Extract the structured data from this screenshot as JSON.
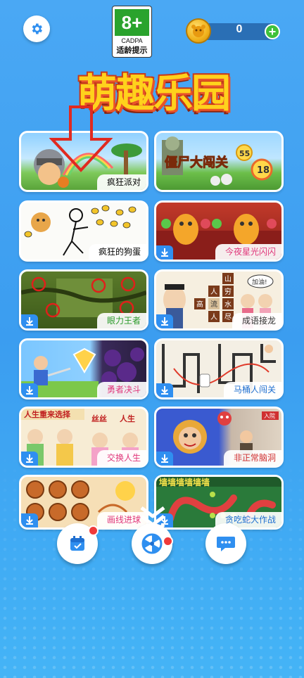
{
  "header": {
    "age_rating": "8+",
    "age_org": "CADPA",
    "age_tip": "适龄提示",
    "coins": "0",
    "plus_label": "+"
  },
  "logo_text": "萌趣乐园",
  "games": [
    {
      "label": "疯狂派对",
      "label_color": "#333333",
      "download": false
    },
    {
      "label": "",
      "label_color": "#333333",
      "download": false
    },
    {
      "label": "疯狂的狗蛋",
      "label_color": "#333333",
      "download": false
    },
    {
      "label": "今夜星光闪闪",
      "label_color": "#e0367a",
      "download": true
    },
    {
      "label": "眼力王者",
      "label_color": "#2a9a2a",
      "download": true
    },
    {
      "label": "成语接龙",
      "label_color": "#333333",
      "download": true
    },
    {
      "label": "勇者决斗",
      "label_color": "#e0367a",
      "download": true
    },
    {
      "label": "马桶人闯关",
      "label_color": "#1f6fd0",
      "download": true
    },
    {
      "label": "交换人生",
      "label_color": "#e0367a",
      "download": true
    },
    {
      "label": "非正常脑洞",
      "label_color": "#d03030",
      "download": true
    },
    {
      "label": "画线进球",
      "label_color": "#e0367a",
      "download": true
    },
    {
      "label": "贪吃蛇大作战",
      "label_color": "#1f6fd0",
      "download": true
    }
  ],
  "thumb_texts": {
    "pvz_title": "僵尸大闯关",
    "sun_55": "55",
    "sun_18": "18",
    "idiom_chars": [
      "山",
      "穷",
      "人",
      "水",
      "高",
      "流",
      "尽",
      "人"
    ],
    "idiom_bubble": "加油!",
    "swap_title": "人生重来选择",
    "swap_tag1": "丝丝",
    "swap_tag2": "人生",
    "snake_wall": "墙墙墙墙墙墙",
    "brain_tag": "入院"
  },
  "colors": {
    "accent": "#2f8ff0",
    "badge_red": "#f03a3a",
    "age_green": "#2aa32d"
  },
  "icons": [
    "gear-icon",
    "coin-icon",
    "plus-icon",
    "download-icon",
    "calendar-icon",
    "wheel-icon",
    "chat-icon",
    "chevron-down-icon",
    "arrow-down-icon"
  ]
}
